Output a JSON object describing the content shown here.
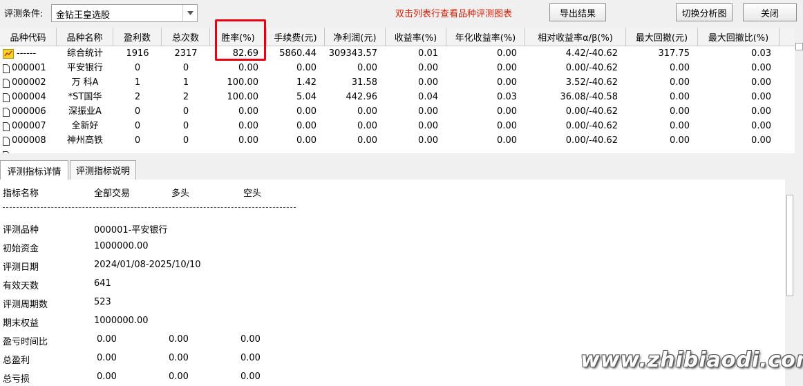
{
  "toolbar": {
    "condition_label": "评测条件:",
    "condition_value": "金钻王皇选股",
    "hint": "双击列表行查看品种评测图表",
    "export_label": "导出结果",
    "switch_label": "切换分析图",
    "close_label": "关闭",
    "hint_color": "#d81e06"
  },
  "grid": {
    "columns": [
      "品种代码",
      "品种名称",
      "盈利数",
      "总次数",
      "胜率(%)",
      "手续费(元)",
      "净利润(元)",
      "收益率(%)",
      "年化收益率(%)",
      "相对收益率α/β(%)",
      "最大回撤(元)",
      "最大回撤比(%)"
    ],
    "rows": [
      {
        "icon": "chart-icon",
        "code": "------",
        "name": "综合统计",
        "win": "1916",
        "total": "2317",
        "rate": "82.69",
        "fee": "5860.44",
        "profit": "309343.57",
        "ret": "0.01",
        "annual": "0.00",
        "rel": "4.42/-40.62",
        "dd": "317.75",
        "ddr": "0.03"
      },
      {
        "icon": "doc-icon",
        "code": "000001",
        "name": "平安银行",
        "win": "0",
        "total": "0",
        "rate": "0.00",
        "fee": "0.00",
        "profit": "0.00",
        "ret": "0.00",
        "annual": "0.00",
        "rel": "0.00/-40.62",
        "dd": "0.00",
        "ddr": "0.00"
      },
      {
        "icon": "doc-icon",
        "code": "000002",
        "name": "万 科A",
        "win": "1",
        "total": "1",
        "rate": "100.00",
        "fee": "1.42",
        "profit": "31.58",
        "ret": "0.00",
        "annual": "0.00",
        "rel": "3.52/-40.62",
        "dd": "0.00",
        "ddr": "0.00"
      },
      {
        "icon": "doc-icon",
        "code": "000004",
        "name": "*ST国华",
        "win": "2",
        "total": "2",
        "rate": "100.00",
        "fee": "5.04",
        "profit": "442.96",
        "ret": "0.04",
        "annual": "0.03",
        "rel": "36.08/-40.58",
        "dd": "0.00",
        "ddr": "0.00"
      },
      {
        "icon": "doc-icon",
        "code": "000006",
        "name": "深振业A",
        "win": "0",
        "total": "0",
        "rate": "0.00",
        "fee": "0.00",
        "profit": "0.00",
        "ret": "0.00",
        "annual": "0.00",
        "rel": "0.00/-40.62",
        "dd": "0.00",
        "ddr": "0.00"
      },
      {
        "icon": "doc-icon",
        "code": "000007",
        "name": "全新好",
        "win": "0",
        "total": "0",
        "rate": "0.00",
        "fee": "0.00",
        "profit": "0.00",
        "ret": "0.00",
        "annual": "0.00",
        "rel": "0.00/-40.62",
        "dd": "0.00",
        "ddr": "0.00"
      },
      {
        "icon": "doc-icon",
        "code": "000008",
        "name": "神州高铁",
        "win": "0",
        "total": "0",
        "rate": "0.00",
        "fee": "0.00",
        "profit": "0.00",
        "ret": "0.00",
        "annual": "0.00",
        "rel": "0.00/-40.62",
        "dd": "0.00",
        "ddr": "0.00"
      }
    ]
  },
  "tabs": [
    "评测指标详情",
    "评测指标说明"
  ],
  "detail": {
    "headers": [
      "指标名称",
      "全部交易",
      "多头",
      "空头"
    ],
    "divider": "------------------------------------------------------------------------------------",
    "items": [
      {
        "label": "评测品种",
        "value": "000001-平安银行"
      },
      {
        "label": "初始资金",
        "value": "1000000.00"
      },
      {
        "label": "评测日期",
        "value": "2024/01/08-2025/10/10"
      },
      {
        "label": "有效天数",
        "value": "641"
      },
      {
        "label": "评测周期数",
        "value": "523"
      },
      {
        "label": "期末权益",
        "value": "1000000.00"
      }
    ],
    "triples": [
      {
        "label": "盈亏时间比",
        "v1": "0.00",
        "v2": "0.00",
        "v3": "0.00"
      },
      {
        "label": "总盈利",
        "v1": "0.00",
        "v2": "0.00",
        "v3": "0.00"
      },
      {
        "label": "总亏损",
        "v1": "0.00",
        "v2": "0.00",
        "v3": "0.00"
      }
    ]
  },
  "watermark": "www.zhibiaodi.com"
}
